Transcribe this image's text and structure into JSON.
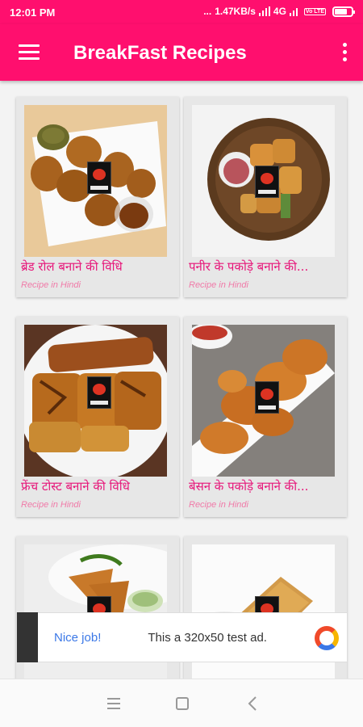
{
  "status_bar": {
    "time": "12:01 PM",
    "dots": "...",
    "speed": "1.47KB/s",
    "network": "4G",
    "volte": "Vo LTE",
    "icons": [
      "signal-icon",
      "battery-icon"
    ]
  },
  "app_bar": {
    "title": "BreakFast Recipes",
    "icons": [
      "menu-icon",
      "more-vert-icon"
    ]
  },
  "recipes": [
    {
      "title": "ब्रेड रोल बनाने की विधि",
      "subtitle": "Recipe in Hindi"
    },
    {
      "title": "पनीर के पकोड़े बनाने की...",
      "subtitle": "Recipe in Hindi"
    },
    {
      "title": "फ्रेंच टोस्ट बनाने की विधि",
      "subtitle": "Recipe in Hindi"
    },
    {
      "title": "बेसन के पकोड़े बनाने की...",
      "subtitle": "Recipe in Hindi"
    },
    {
      "title": "",
      "subtitle": ""
    },
    {
      "title": "",
      "subtitle": ""
    }
  ],
  "ad": {
    "nice": "Nice job!",
    "text": "This a 320x50 test ad.",
    "icon": "ad-logo-icon"
  },
  "nav_bar": {
    "icons": [
      "recent-apps-icon",
      "home-icon",
      "back-icon"
    ]
  },
  "colors": {
    "accent": "#ff0f6e",
    "title_text": "#e7167a",
    "subtitle_text": "#f07aa8",
    "ad_link": "#3b78e7"
  }
}
